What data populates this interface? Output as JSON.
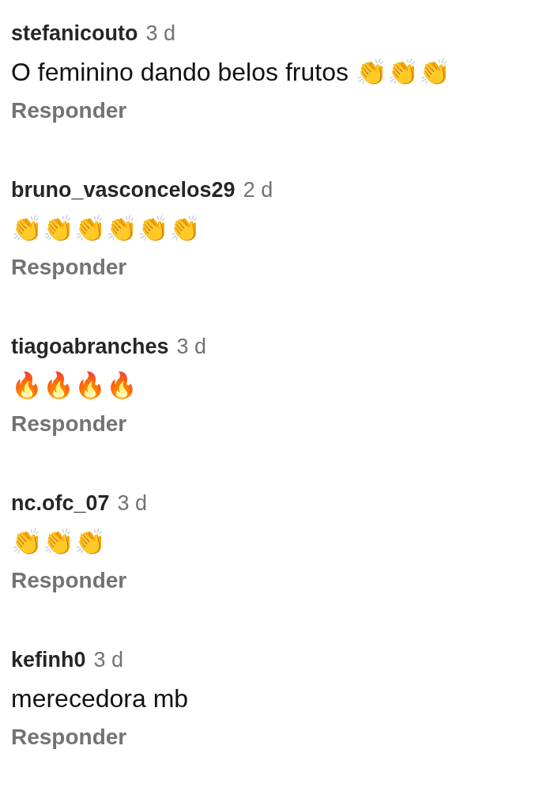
{
  "comments": [
    {
      "username": "stefanicouto",
      "time": "3 d",
      "text": "O feminino dando belos frutos 👏👏👏",
      "reply": "Responder"
    },
    {
      "username": "bruno_vasconcelos29",
      "time": "2 d",
      "text": "👏👏👏👏👏👏",
      "reply": "Responder"
    },
    {
      "username": "tiagoabranches",
      "time": "3 d",
      "text": "🔥🔥🔥🔥",
      "reply": "Responder"
    },
    {
      "username": "nc.ofc_07",
      "time": "3 d",
      "text": "👏👏👏",
      "reply": "Responder"
    },
    {
      "username": "kefinh0",
      "time": "3 d",
      "text": "merecedora mb",
      "reply": "Responder"
    }
  ]
}
